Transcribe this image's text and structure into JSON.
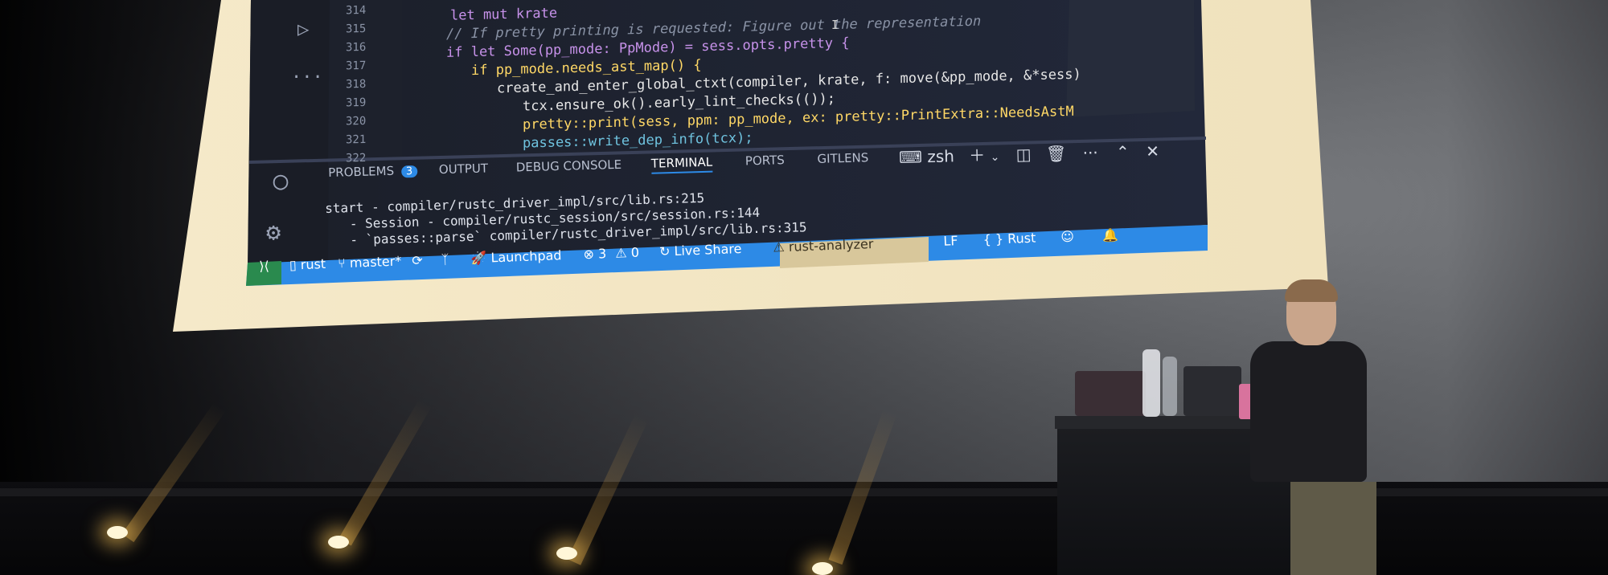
{
  "editor": {
    "line_numbers": [
      "314",
      "315",
      "316",
      "317",
      "318",
      "319",
      "320",
      "321",
      "322"
    ],
    "code_lines": [
      "let mut krate",
      "// If pretty printing is requested: Figure out the representation",
      "if let Some(pp_mode: PpMode) = sess.opts.pretty {",
      "if pp_mode.needs_ast_map() {",
      "create_and_enter_global_ctxt(compiler, krate, f: move(&pp_mode, &*sess)",
      "tcx.ensure_ok().early_lint_checks(());",
      "pretty::print(sess, ppm: pp_mode, ex: pretty::PrintExtra::NeedsAstM",
      "passes::write_dep_info(tcx);",
      ""
    ],
    "cursor_char": "I"
  },
  "panel": {
    "tabs": [
      "PROBLEMS",
      "OUTPUT",
      "DEBUG CONSOLE",
      "TERMINAL",
      "PORTS",
      "GITLENS"
    ],
    "problems_count": "3",
    "active_tab": "TERMINAL",
    "shell": "zsh"
  },
  "terminal": {
    "lines": [
      "start - compiler/rustc_driver_impl/src/lib.rs:215",
      "- Session - compiler/rustc_session/src/session.rs:144",
      "- `passes::parse` compiler/rustc_driver_impl/src/lib.rs:315"
    ]
  },
  "statusbar": {
    "remote_icon": "remote-icon",
    "repo": "rust",
    "branch": "master*",
    "launchpad": "Launchpad",
    "errors": "3",
    "warnings": "0",
    "live_share": "Live Share",
    "rust_analyzer": "rust-analyzer",
    "line_ending": "LF",
    "language": "Rust"
  },
  "colors": {
    "editor_bg": "#1f2430",
    "statusbar_blue": "#2d8ae6",
    "keyword": "#c792ea",
    "function": "#ffd866",
    "comment": "#8a93a6",
    "type": "#6fc3df",
    "projection_border": "#f3e6c6"
  }
}
